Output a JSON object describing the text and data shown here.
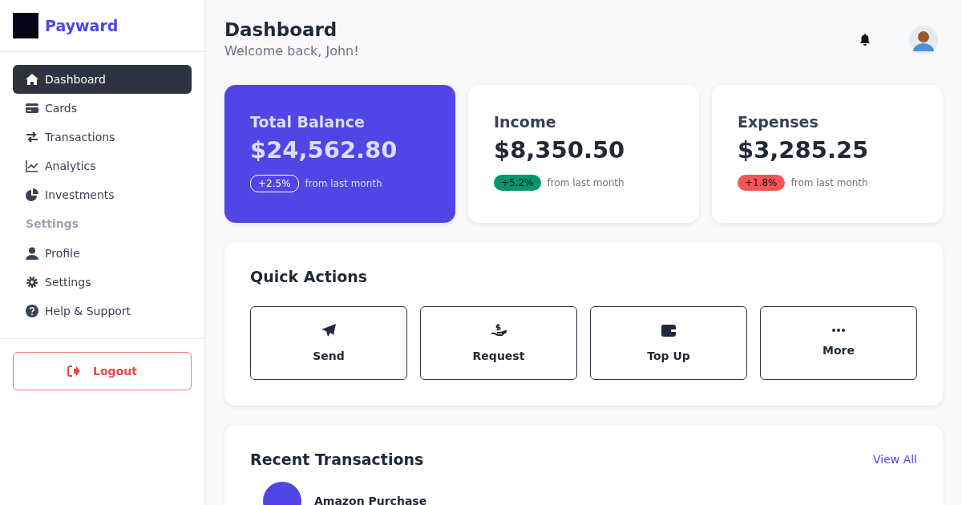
{
  "brand": {
    "name": "Payward"
  },
  "nav": [
    {
      "label": "Dashboard",
      "selected": true
    },
    {
      "label": "Cards",
      "selected": false
    },
    {
      "label": "Transactions",
      "selected": false
    },
    {
      "label": "Analytics",
      "selected": false
    },
    {
      "label": "Investments",
      "selected": false
    }
  ],
  "settings_heading": "Settings",
  "settings_nav": [
    {
      "label": "Profile",
      "selected": false
    },
    {
      "label": "Settings",
      "selected": false
    },
    {
      "label": "Help & Support",
      "selected": false
    }
  ],
  "logout": "Logout",
  "header": {
    "title": "Dashboard",
    "subtitle": "Welcome back, John!"
  },
  "stats": [
    {
      "kind": "primary",
      "title": "Total Balance",
      "amount": "$24,562.80",
      "change": "+2.5%",
      "color": "#ffffff",
      "note": "from last month"
    },
    {
      "kind": "plain",
      "title": "Income",
      "amount": "$8,350.50",
      "change": "+5.2%",
      "color": "#059669",
      "note": "from last month"
    },
    {
      "kind": "plain",
      "title": "Expenses",
      "amount": "$3,285.25",
      "change": "+1.8%",
      "color": "#f75555",
      "note": "from last month"
    }
  ],
  "quick_actions": {
    "title": "Quick Actions",
    "actions": [
      "Send",
      "Request",
      "Top Up",
      "More"
    ]
  },
  "recent": {
    "title": "Recent Transactions",
    "view_all": "View All",
    "items": [
      {
        "name": "Amazon Purchase"
      }
    ]
  }
}
